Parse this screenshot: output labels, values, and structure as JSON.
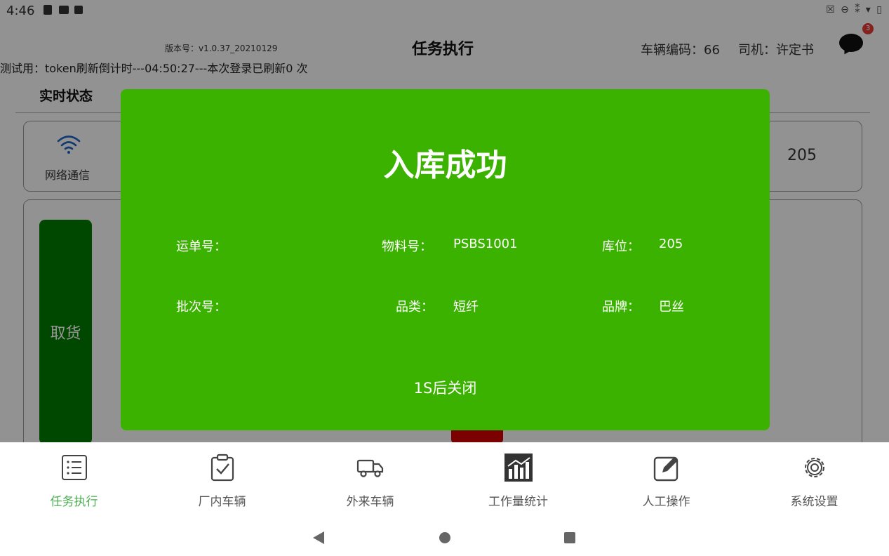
{
  "status_bar": {
    "time": "4:46",
    "right_icons": "☒ ⊖ ⁑ ▾ ▯"
  },
  "header": {
    "version": "版本号：v1.0.37_20210129",
    "title": "任务执行",
    "vehicle": "车辆编码：66",
    "driver": "司机：许定书",
    "notification_count": "3"
  },
  "debug_line": "测试用：token刷新倒计时---04:50:27---本次登录已刷新0 次",
  "realtime": {
    "section_title": "实时状态",
    "network_label": "网络通信",
    "location_value": "205"
  },
  "actions": {
    "pickup_label": "取货"
  },
  "modal": {
    "title": "入库成功",
    "waybill_label": "运单号：",
    "waybill_value": "",
    "material_label": "物料号：",
    "material_value": "PSBS1001",
    "location_label": "库位：",
    "location_value": "205",
    "batch_label": "批次号：",
    "batch_value": "",
    "category_label": "品类：",
    "category_value": "短纤",
    "brand_label": "品牌：",
    "brand_value": "巴丝",
    "close_hint": "1S后关闭"
  },
  "bottom_nav": {
    "items": [
      {
        "label": "任务执行",
        "icon": "list-icon",
        "active": true
      },
      {
        "label": "厂内车辆",
        "icon": "clipboard-check-icon",
        "active": false
      },
      {
        "label": "外来车辆",
        "icon": "truck-icon",
        "active": false
      },
      {
        "label": "工作量统计",
        "icon": "bar-chart-icon",
        "active": false
      },
      {
        "label": "人工操作",
        "icon": "edit-icon",
        "active": false
      },
      {
        "label": "系统设置",
        "icon": "gear-icon",
        "active": false
      }
    ]
  },
  "colors": {
    "modal_green": "#3cb200",
    "pickup_green": "#007a00",
    "active_nav": "#4caf50",
    "badge_red": "#e53935"
  }
}
